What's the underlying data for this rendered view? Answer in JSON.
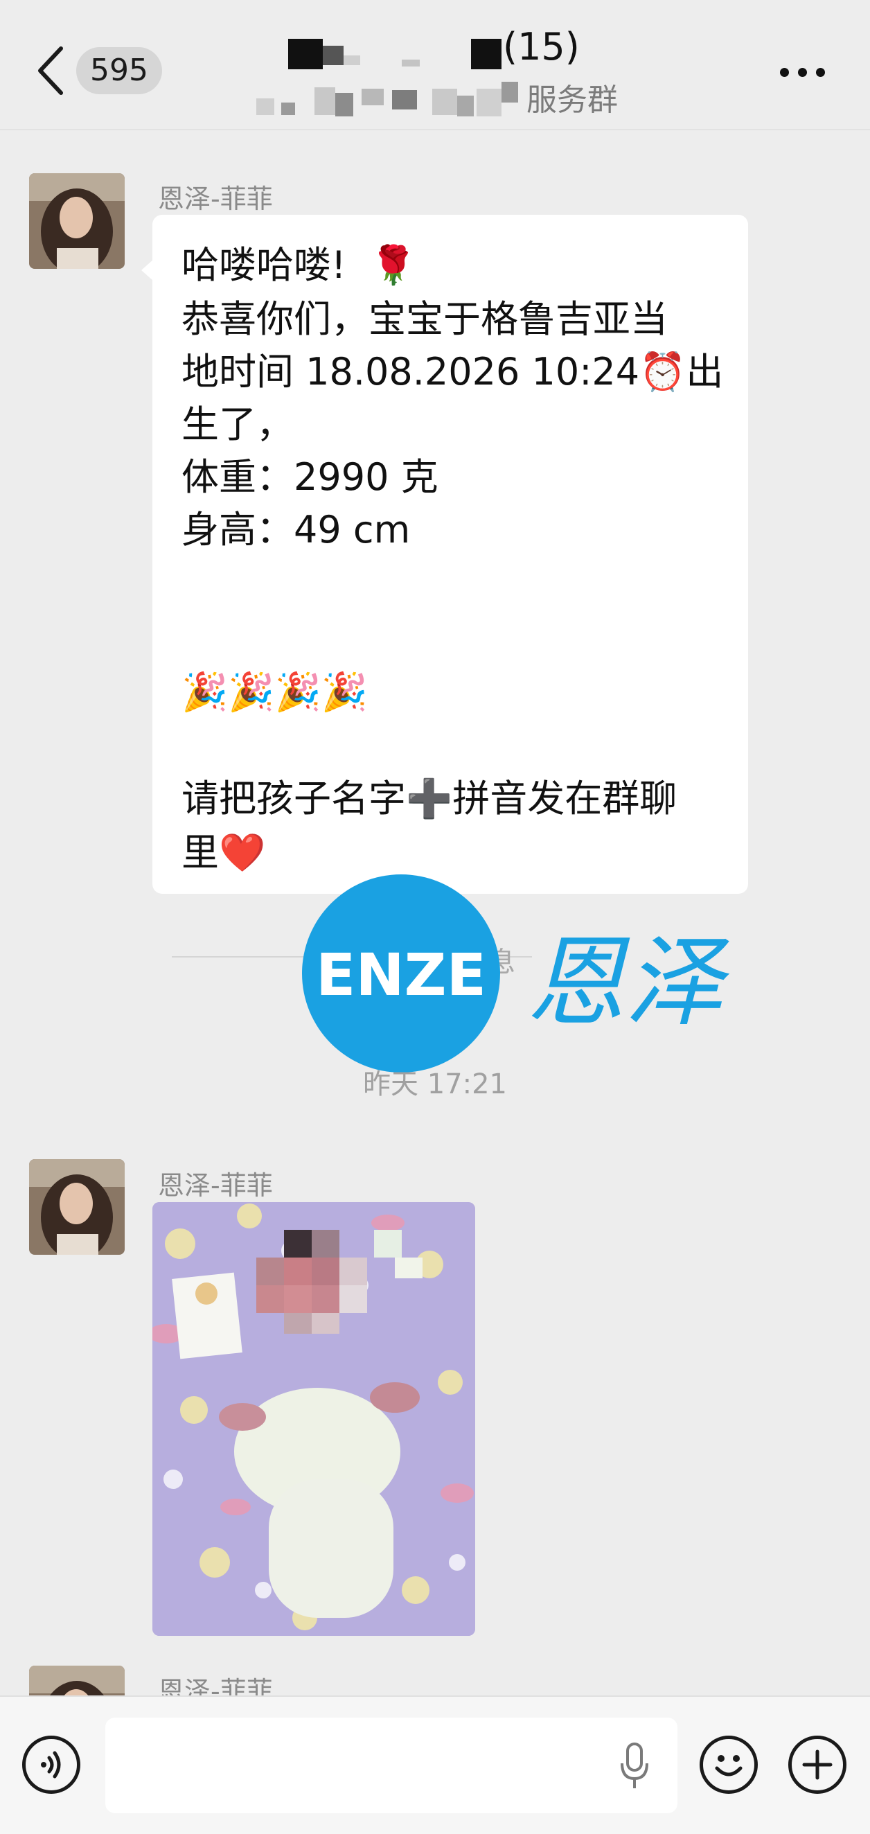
{
  "header": {
    "unread_count": "595",
    "member_count": "(15)",
    "group_suffix": "服务群"
  },
  "messages": [
    {
      "sender": "恩泽-菲菲",
      "lines": [
        "哈喽哈喽!  🌹",
        "恭喜你们，宝宝于格鲁吉亚当",
        "地时间 18.08.2026 10:24⏰出",
        "生了，",
        "体重：2990 克",
        "身高：49 cm",
        "🎉🎉🎉🎉",
        "请把孩子名字➕拼音发在群聊",
        "里❤️"
      ]
    },
    {
      "sender": "恩泽-菲菲"
    },
    {
      "sender": "恩泽-菲菲"
    }
  ],
  "divider_text": "息",
  "timestamp": "昨天 17:21",
  "watermark": {
    "logo_text": "ENZE",
    "brand_text": "恩泽",
    "color": "#1aa1e2"
  },
  "icons": {
    "back": "chevron-left-icon",
    "more": "more-dots-icon",
    "voice": "voice-icon",
    "mic": "microphone-icon",
    "emoji": "emoji-icon",
    "plus": "plus-icon"
  }
}
